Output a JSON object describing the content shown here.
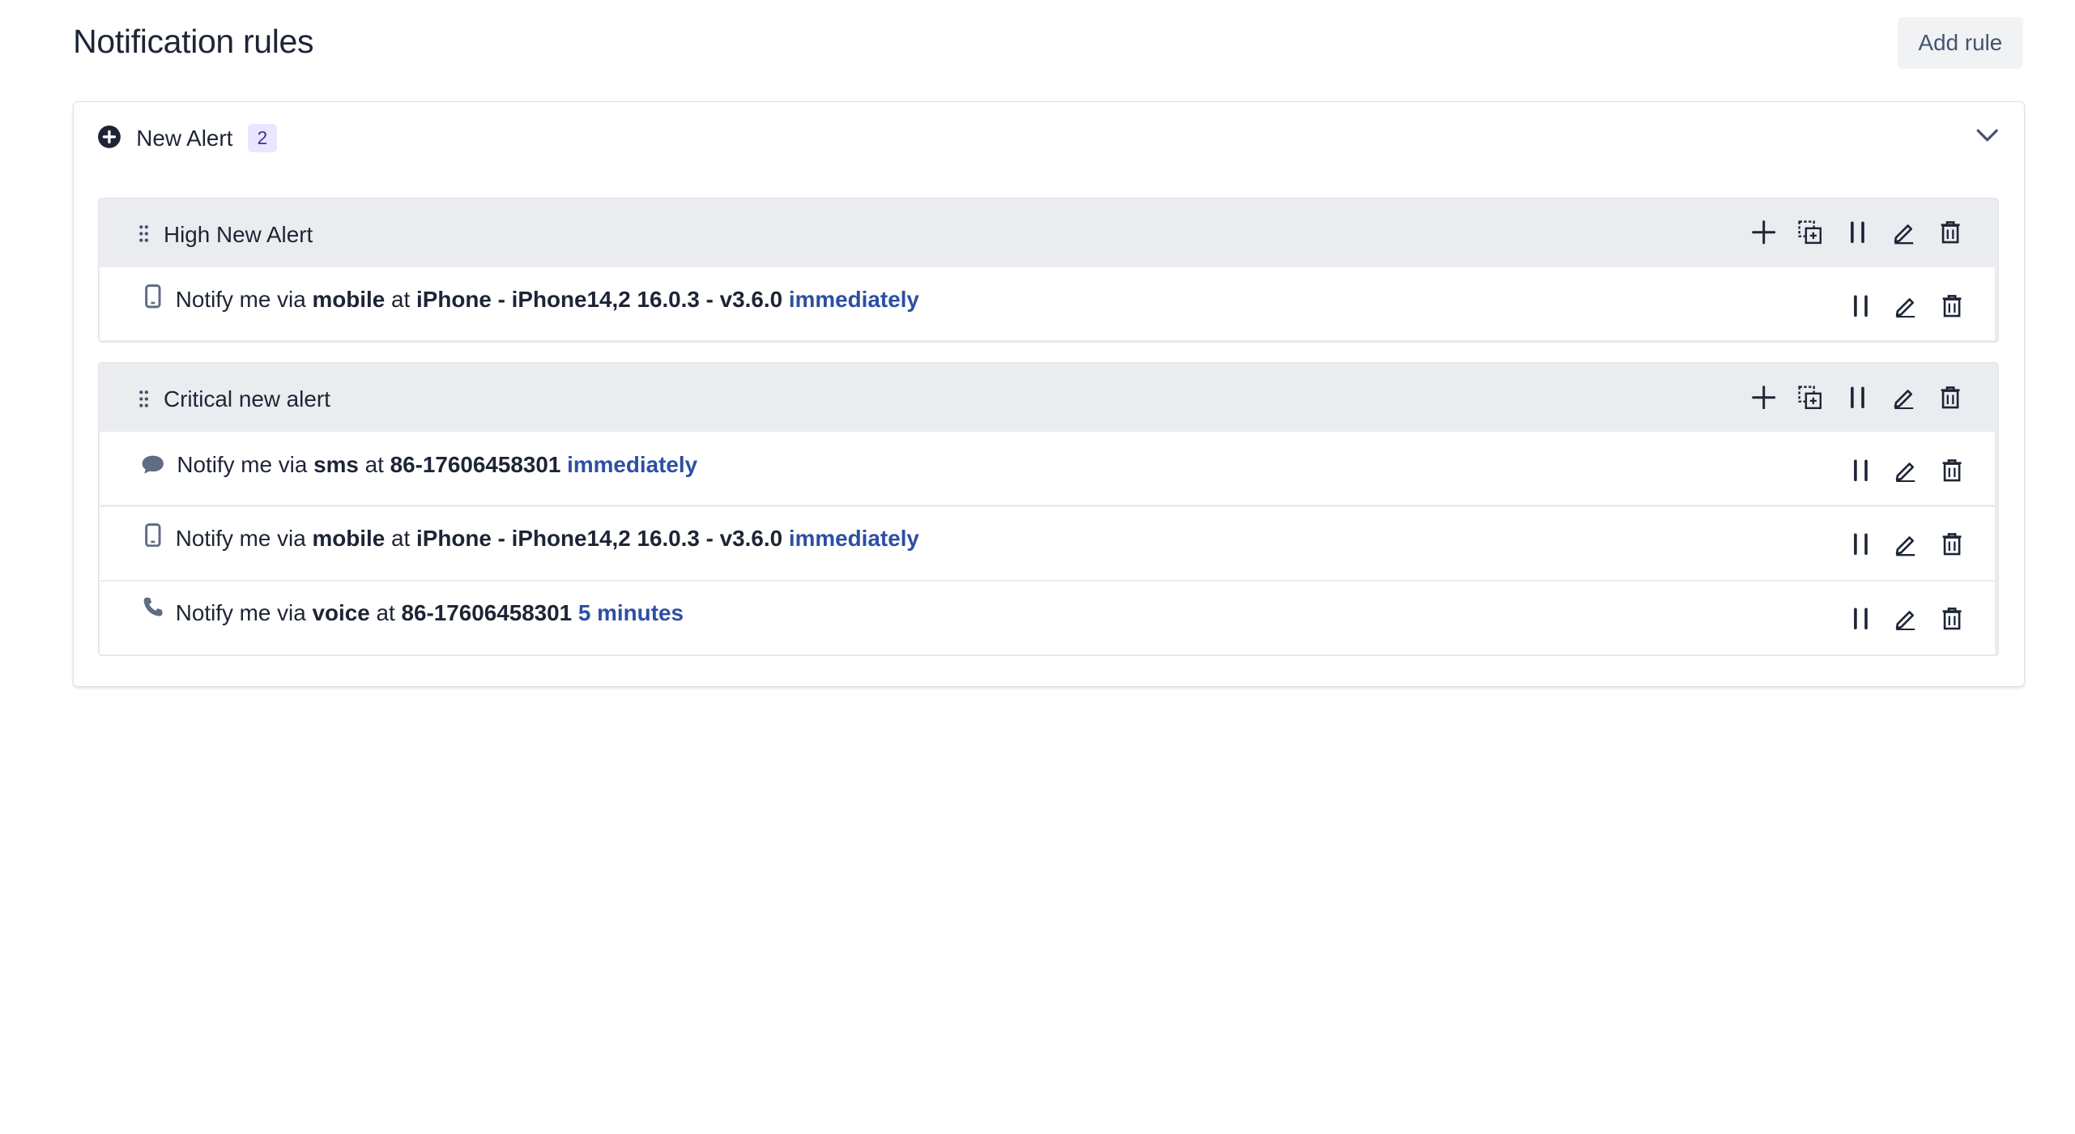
{
  "page_title": "Notification rules",
  "add_rule_label": "Add rule",
  "alert": {
    "name": "New Alert",
    "count": "2"
  },
  "groups": [
    {
      "title": "High New Alert",
      "rules": [
        {
          "prefix": "Notify me via",
          "channel": "mobile",
          "at": "at",
          "target": "iPhone - iPhone14,2 16.0.3 - v3.6.0",
          "timing": "immediately",
          "icon": "mobile-icon"
        }
      ]
    },
    {
      "title": "Critical new alert",
      "rules": [
        {
          "prefix": "Notify me via",
          "channel": "sms",
          "at": "at",
          "target": "86-17606458301",
          "timing": "immediately",
          "icon": "chat-bubble-icon"
        },
        {
          "prefix": "Notify me via",
          "channel": "mobile",
          "at": "at",
          "target": "iPhone - iPhone14,2 16.0.3 - v3.6.0",
          "timing": "immediately",
          "icon": "mobile-icon"
        },
        {
          "prefix": "Notify me via",
          "channel": "voice",
          "at": "at",
          "target": "86-17606458301",
          "timing": "5 minutes",
          "icon": "phone-icon"
        }
      ]
    }
  ],
  "colors": {
    "group_bg": "#ebecf0",
    "timing_link": "#2d4fa3",
    "badge_bg": "#eae6ff"
  }
}
